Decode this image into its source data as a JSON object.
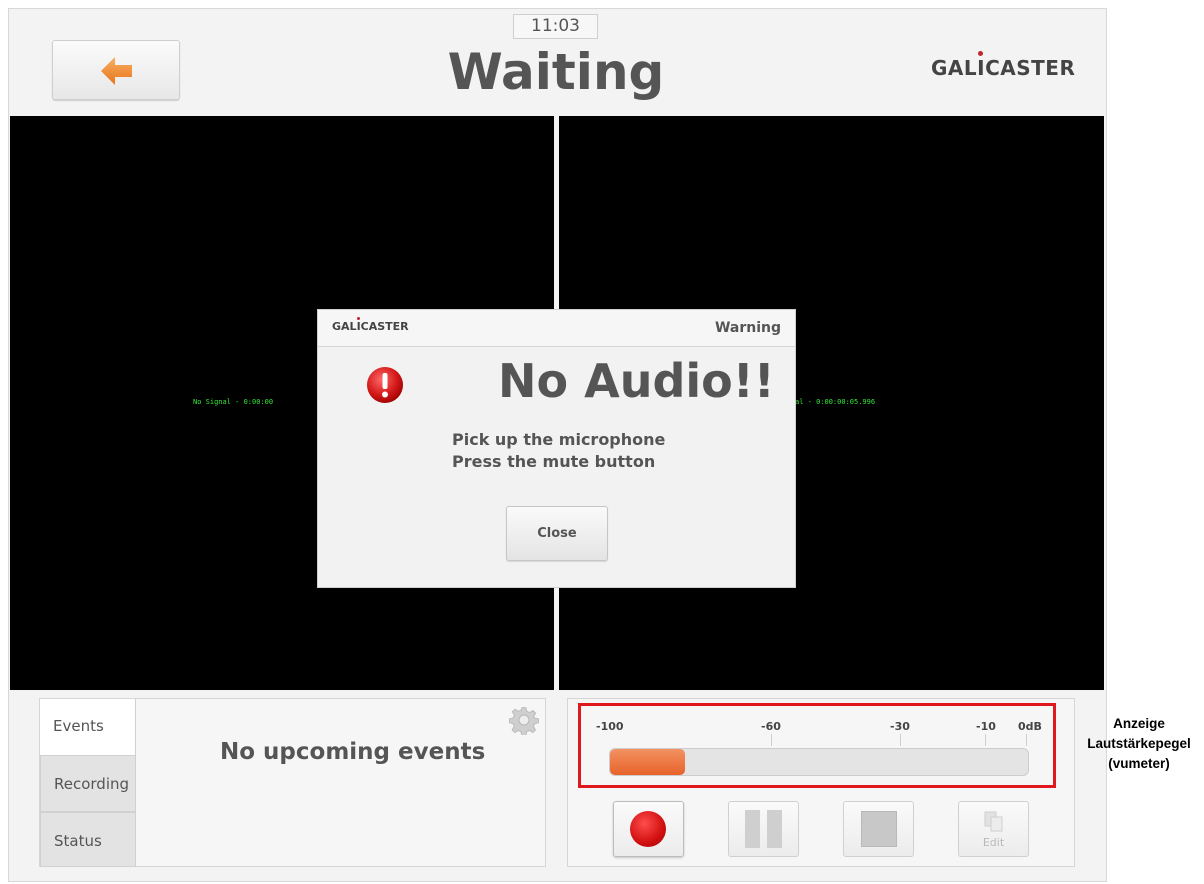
{
  "header": {
    "clock": "11:03",
    "title": "Waiting",
    "logo_prefix": "GAL",
    "logo_i": "I",
    "logo_suffix": "CASTER"
  },
  "video": {
    "left_overlay": "No Signal - 0:00:00",
    "right_overlay": "al - 0:00:00:05.996"
  },
  "dialog": {
    "logo_prefix": "GAL",
    "logo_i": "I",
    "logo_suffix": "CASTER",
    "header_label": "Warning",
    "title": "No Audio!!",
    "line1": "Pick up the microphone",
    "line2": "Press the mute button",
    "close_label": "Close"
  },
  "events_panel": {
    "tabs": [
      {
        "label": "Events",
        "active": true
      },
      {
        "label": "Recording",
        "active": false
      },
      {
        "label": "Status",
        "active": false
      }
    ],
    "message": "No upcoming events"
  },
  "vumeter": {
    "scale_labels": [
      "-100",
      "-60",
      "-30",
      "-10",
      "0dB"
    ],
    "level_fraction": 0.18,
    "fill_color": "#e7622a"
  },
  "controls": {
    "edit_label": "Edit"
  },
  "annotation": {
    "line1": "Anzeige",
    "line2": "Lautstärkepegel",
    "line3": "(vumeter)",
    "highlight_color": "#e0191e"
  }
}
